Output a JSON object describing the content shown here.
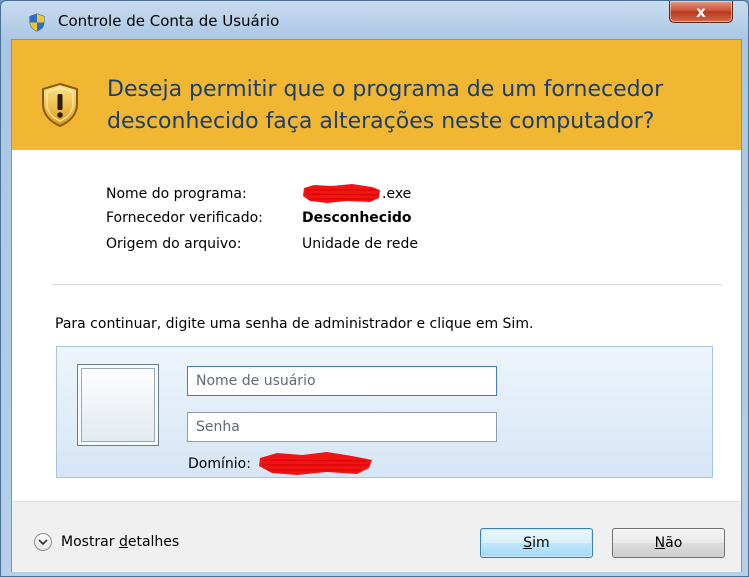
{
  "window": {
    "title": "Controle de Conta de Usuário",
    "close_label": "x"
  },
  "banner": {
    "question_line1": "Deseja permitir que o programa de um fornecedor",
    "question_line2": "desconhecido faça alterações neste computador?",
    "bg_color": "#f2b732",
    "text_color": "#1a3e72"
  },
  "details": {
    "program_name_label": "Nome do programa:",
    "program_name_suffix": ".exe",
    "publisher_label": "Fornecedor verificado:",
    "publisher_value": "Desconhecido",
    "origin_label": "Origem do arquivo:",
    "origin_value": "Unidade de rede"
  },
  "instruction": "Para continuar, digite uma senha de administrador e clique em Sim.",
  "credentials": {
    "username_placeholder": "Nome de usuário",
    "username_value": "",
    "password_placeholder": "Senha",
    "password_value": "",
    "domain_label": "Domínio:"
  },
  "footer": {
    "show_details_prefix": "Mostrar ",
    "show_details_mnemonic": "d",
    "show_details_rest": "etalhes",
    "yes_mnemonic": "S",
    "yes_rest": "im",
    "no_mnemonic": "N",
    "no_rest": "ão"
  },
  "icons": {
    "title": "uac-shield-icon",
    "banner": "warning-shield-icon",
    "details_toggle": "chevron-down-icon",
    "user_tile": "user-tile"
  }
}
